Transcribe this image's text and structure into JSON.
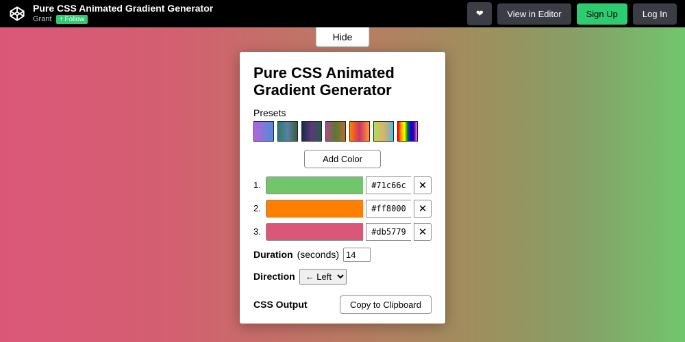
{
  "header": {
    "title": "Pure CSS Animated Gradient Generator",
    "author": "Grant",
    "follow_label": "Follow",
    "view_editor_label": "View in Editor",
    "signup_label": "Sign Up",
    "login_label": "Log In"
  },
  "panel": {
    "hide_label": "Hide",
    "heading": "Pure CSS Animated Gradient Generator",
    "presets_label": "Presets",
    "add_color_label": "Add Color",
    "colors": [
      {
        "idx": "1.",
        "hex": "#71c66c",
        "css": "#71c66c"
      },
      {
        "idx": "2.",
        "hex": "#ff8000",
        "css": "#ff8000"
      },
      {
        "idx": "3.",
        "hex": "#db5779",
        "css": "#db5779"
      }
    ],
    "duration_label": "Duration",
    "duration_unit": "(seconds)",
    "duration_value": "14",
    "direction_label": "Direction",
    "direction_value": "← Left",
    "output_label": "CSS Output",
    "copy_label": "Copy to Clipboard"
  }
}
